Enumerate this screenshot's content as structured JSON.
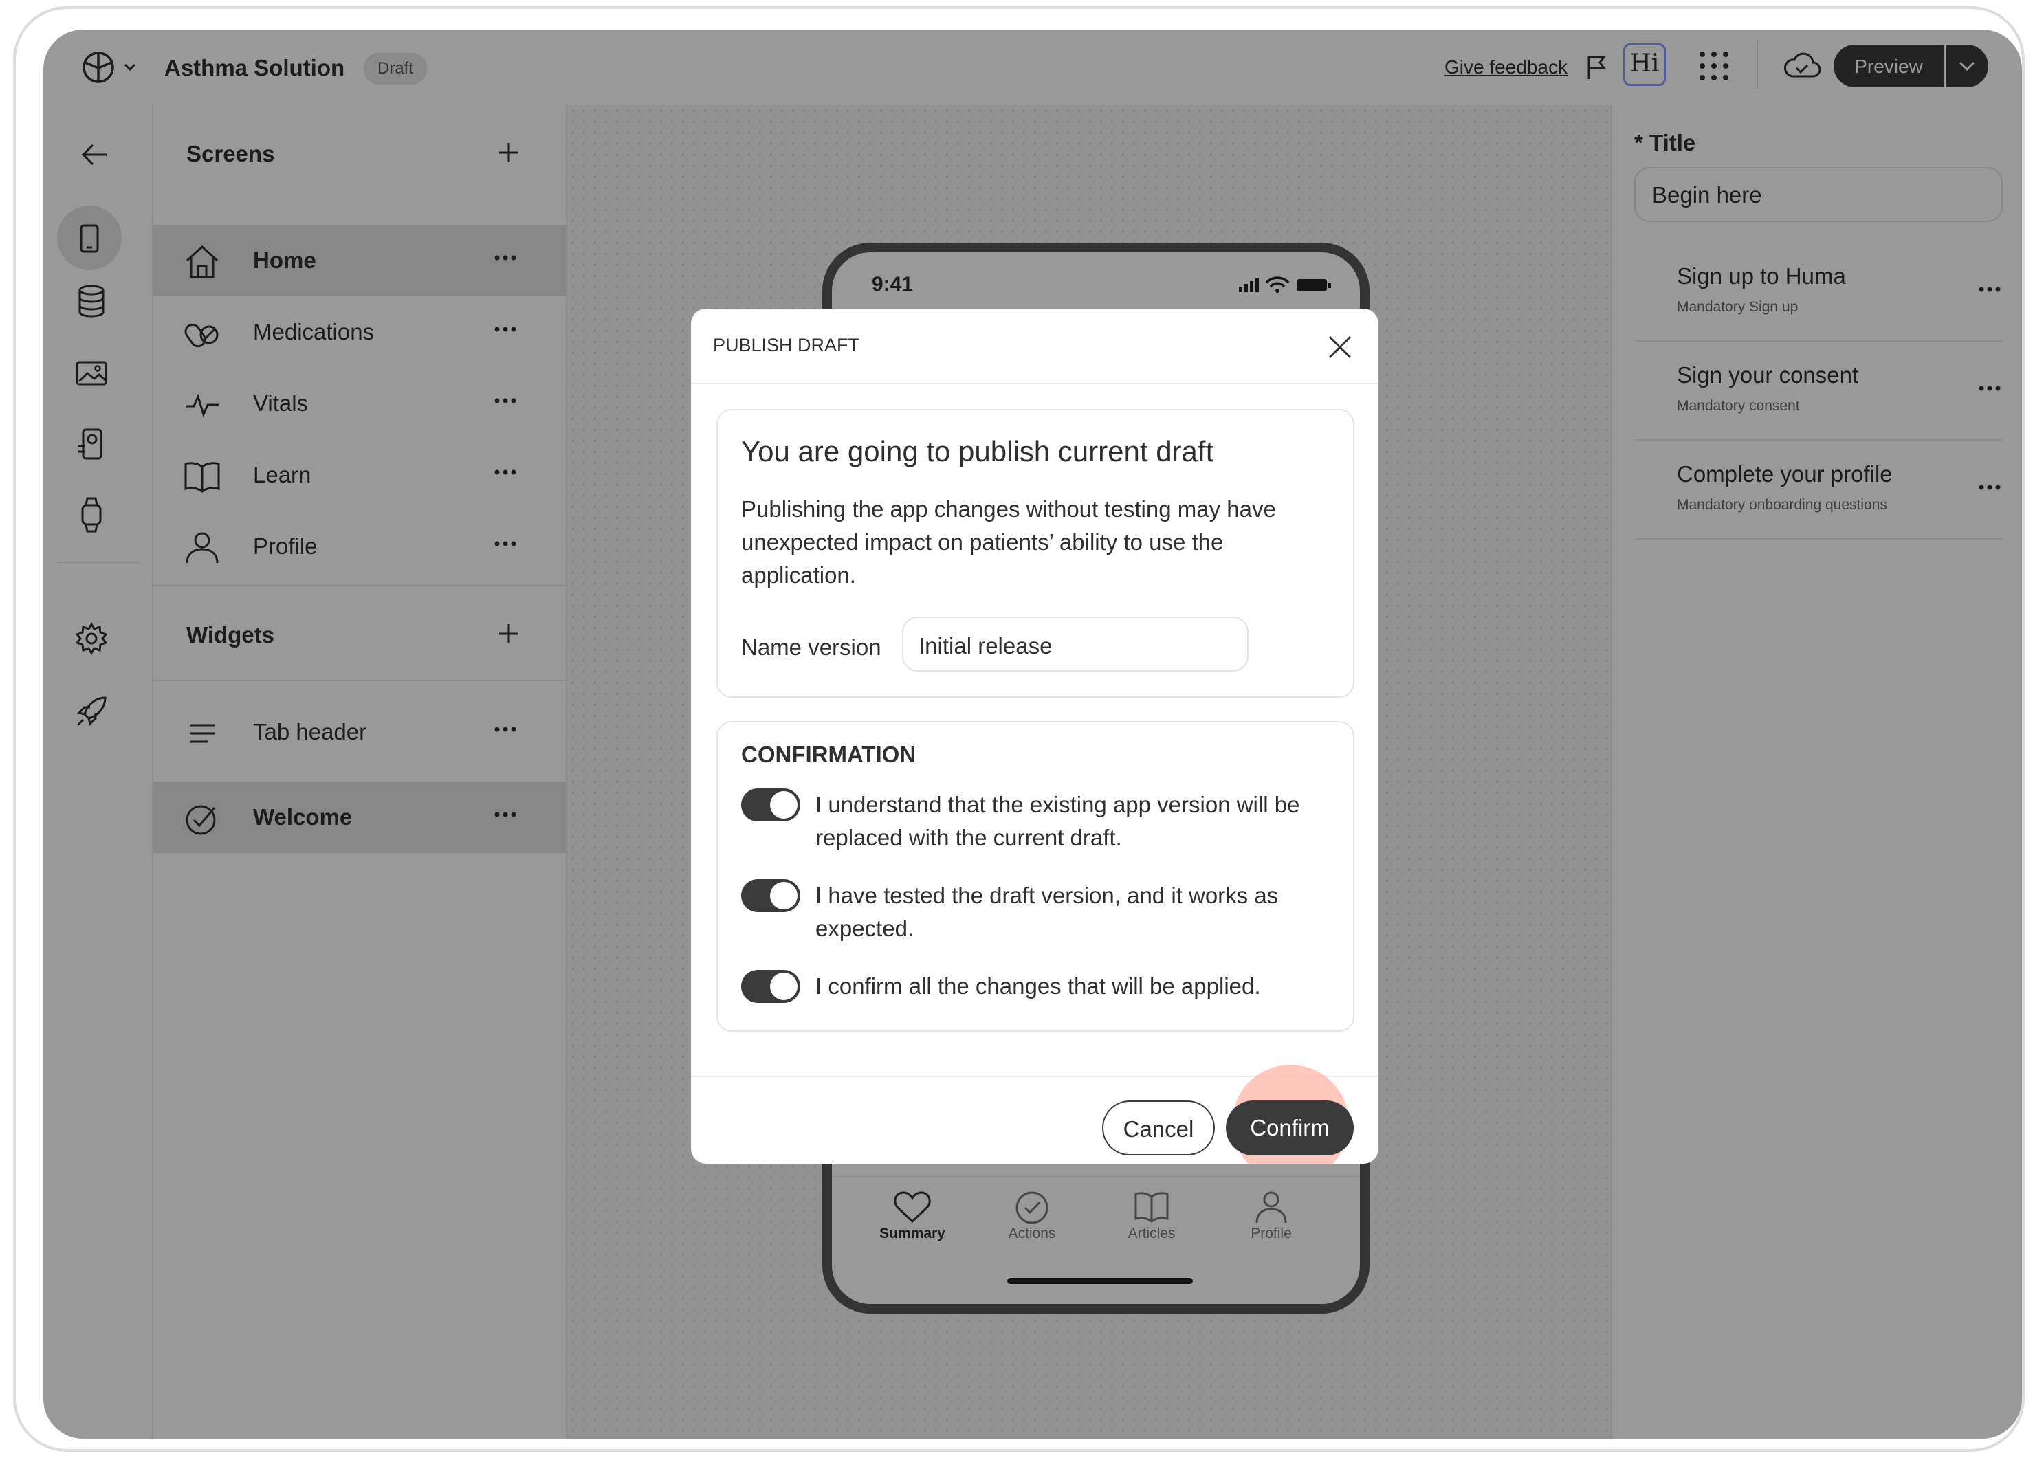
{
  "header": {
    "app_title": "Asthma Solution",
    "status_badge": "Draft",
    "feedback_link": "Give feedback",
    "avatar_text": "Hi",
    "preview_label": "Preview"
  },
  "left_rail": {
    "icons": [
      "back-arrow-icon",
      "phone-icon",
      "database-icon",
      "image-icon",
      "integration-icon",
      "watch-icon",
      "gear-icon",
      "rocket-icon"
    ]
  },
  "screens_panel": {
    "screens_title": "Screens",
    "screens": [
      {
        "label": "Home",
        "icon": "home-icon",
        "selected": true
      },
      {
        "label": "Medications",
        "icon": "pills-icon",
        "selected": false
      },
      {
        "label": "Vitals",
        "icon": "pulse-icon",
        "selected": false
      },
      {
        "label": "Learn",
        "icon": "book-icon",
        "selected": false
      },
      {
        "label": "Profile",
        "icon": "person-icon",
        "selected": false
      }
    ],
    "widgets_title": "Widgets",
    "widgets": [
      {
        "label": "Tab header",
        "icon": "lines-icon",
        "selected": false
      },
      {
        "label": "Welcome",
        "icon": "check-circle-icon",
        "selected": true
      }
    ]
  },
  "phone": {
    "time": "9:41",
    "tabs": [
      {
        "label": "Summary",
        "icon": "heart-icon",
        "active": true
      },
      {
        "label": "Actions",
        "icon": "check-circle-icon",
        "active": false
      },
      {
        "label": "Articles",
        "icon": "book-icon",
        "active": false
      },
      {
        "label": "Profile",
        "icon": "person-icon",
        "active": false
      }
    ]
  },
  "right_panel": {
    "title_label": "* Title",
    "title_value": "Begin here",
    "items": [
      {
        "title": "Sign up to Huma",
        "subtitle": "Mandatory Sign up"
      },
      {
        "title": "Sign your consent",
        "subtitle": "Mandatory consent"
      },
      {
        "title": "Complete your profile",
        "subtitle": "Mandatory onboarding questions"
      }
    ]
  },
  "modal": {
    "title": "PUBLISH DRAFT",
    "heading": "You are going to publish current draft",
    "body": "Publishing the app changes without testing may have unexpected impact on patients’ ability to use the application.",
    "name_version_label": "Name version",
    "name_version_value": "Initial release",
    "confirmation_title": "CONFIRMATION",
    "confirmations": [
      {
        "text": "I understand that the existing app version will be replaced with the current draft.",
        "checked": true
      },
      {
        "text": "I have tested the draft version, and it works as expected.",
        "checked": true
      },
      {
        "text": "I confirm all the changes that will be applied.",
        "checked": true
      }
    ],
    "cancel_label": "Cancel",
    "confirm_label": "Confirm"
  },
  "colors": {
    "accent_dark": "#3b3b3b",
    "overlay": "rgba(0,0,0,0.40)",
    "click_highlight": "#ffb4a8"
  }
}
